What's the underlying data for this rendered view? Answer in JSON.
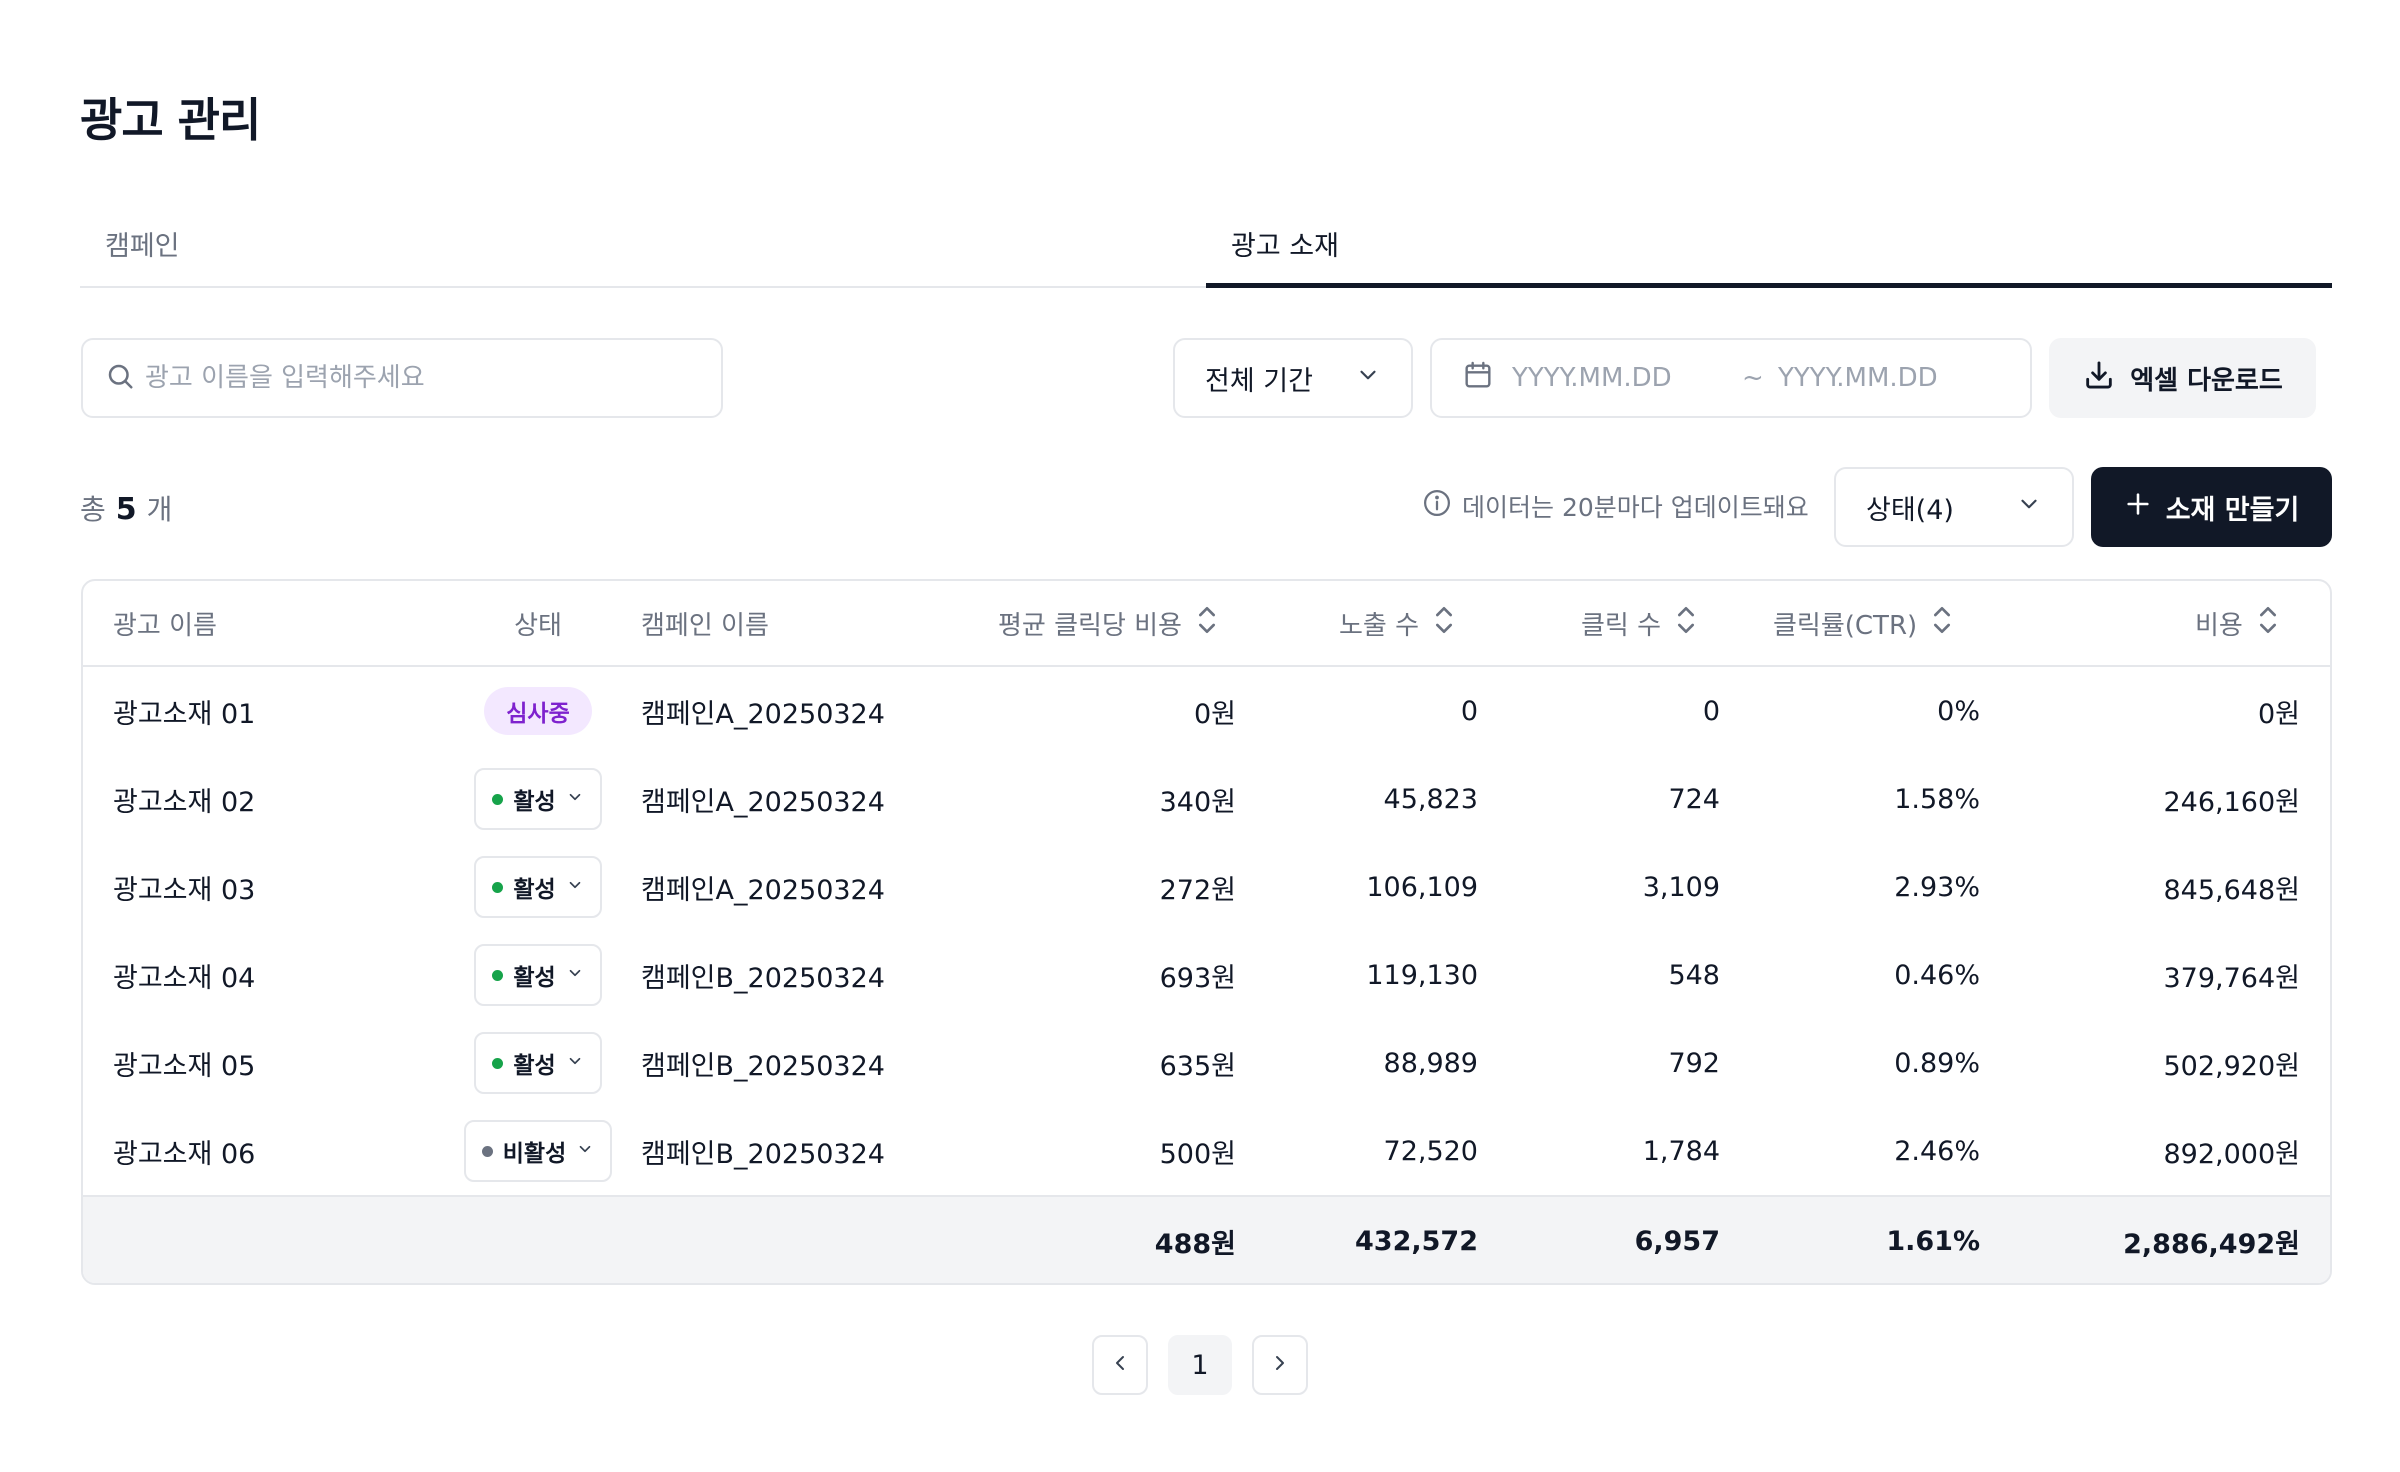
{
  "page": {
    "title": "광고 관리"
  },
  "tabs": [
    {
      "label": "캠페인",
      "active": false
    },
    {
      "label": "광고 소재",
      "active": true
    }
  ],
  "filters": {
    "search_placeholder": "광고 이름을 입력해주세요",
    "period_label": "전체 기간",
    "date_from_placeholder": "YYYY.MM.DD",
    "date_separator": "~",
    "date_to_placeholder": "YYYY.MM.DD",
    "excel_label": "엑셀 다운로드"
  },
  "summary": {
    "total_prefix": "총",
    "total_count": "5",
    "total_suffix": "개",
    "notice": "데이터는 20분마다 업데이트돼요",
    "status_filter_label": "상태(4)",
    "create_label": "소재 만들기"
  },
  "table": {
    "headers": {
      "name": "광고 이름",
      "status": "상태",
      "campaign": "캠페인 이름",
      "cpc": "평균 클릭당 비용",
      "impressions": "노출 수",
      "clicks": "클릭 수",
      "ctr": "클릭률(CTR)",
      "cost": "비용"
    },
    "rows": [
      {
        "name": "광고소재 01",
        "status": "심사중",
        "status_type": "review",
        "campaign": "캠페인A_20250324",
        "cpc": "0원",
        "impressions": "0",
        "clicks": "0",
        "ctr": "0%",
        "cost": "0원"
      },
      {
        "name": "광고소재 02",
        "status": "활성",
        "status_type": "active",
        "campaign": "캠페인A_20250324",
        "cpc": "340원",
        "impressions": "45,823",
        "clicks": "724",
        "ctr": "1.58%",
        "cost": "246,160원"
      },
      {
        "name": "광고소재 03",
        "status": "활성",
        "status_type": "active",
        "campaign": "캠페인A_20250324",
        "cpc": "272원",
        "impressions": "106,109",
        "clicks": "3,109",
        "ctr": "2.93%",
        "cost": "845,648원"
      },
      {
        "name": "광고소재 04",
        "status": "활성",
        "status_type": "active",
        "campaign": "캠페인B_20250324",
        "cpc": "693원",
        "impressions": "119,130",
        "clicks": "548",
        "ctr": "0.46%",
        "cost": "379,764원"
      },
      {
        "name": "광고소재 05",
        "status": "활성",
        "status_type": "active",
        "campaign": "캠페인B_20250324",
        "cpc": "635원",
        "impressions": "88,989",
        "clicks": "792",
        "ctr": "0.89%",
        "cost": "502,920원"
      },
      {
        "name": "광고소재 06",
        "status": "비활성",
        "status_type": "inactive",
        "campaign": "캠페인B_20250324",
        "cpc": "500원",
        "impressions": "72,520",
        "clicks": "1,784",
        "ctr": "2.46%",
        "cost": "892,000원"
      }
    ],
    "totals": {
      "cpc": "488원",
      "impressions": "432,572",
      "clicks": "6,957",
      "ctr": "1.61%",
      "cost": "2,886,492원"
    }
  },
  "pagination": {
    "current_page": "1"
  },
  "colors": {
    "primary_dark": "#111827",
    "active_dot": "#16a34a",
    "inactive_dot": "#6b7280",
    "review_badge_bg": "#f3e8ff",
    "review_badge_text": "#7e22ce",
    "footer_bg": "#f3f4f6"
  },
  "icons": {
    "search": "search-icon",
    "period_chevron": "chevron-down-icon",
    "calendar": "calendar-icon",
    "excel": "download-icon",
    "notice": "info-icon",
    "create": "plus-icon",
    "sort": "sort-icon",
    "prev": "chevron-left-icon",
    "next": "chevron-right-icon"
  }
}
